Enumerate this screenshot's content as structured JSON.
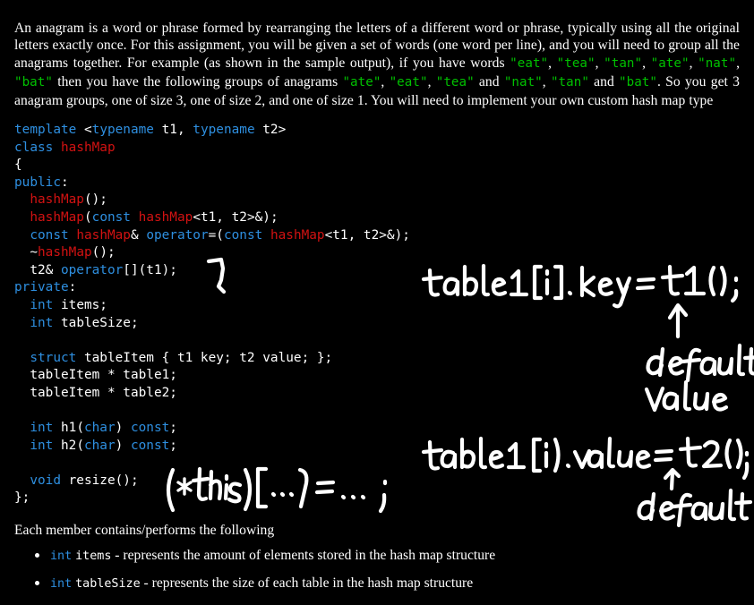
{
  "page": {
    "background_color": "#000000",
    "text_color": "#ffffff"
  },
  "colors": {
    "keyword_blue": "#2e8fe0",
    "class_red": "#d21212",
    "string_green": "#00c000",
    "ink_white": "#ffffff"
  },
  "intro": {
    "part1": "An anagram is a word or phrase formed by rearranging the letters of a different word or phrase, typically using all the original letters exactly once. For this assignment, you will be given a set of words (one word per line), and you will need to group all the anagrams together. For example (as shown in the sample output), if you have words ",
    "w1": "\"eat\"",
    "sep1": ", ",
    "w2": "\"tea\"",
    "sep2": ", ",
    "w3": "\"tan\"",
    "sep3": ", ",
    "w4": "\"ate\"",
    "sep4": ", ",
    "w5": "\"nat\"",
    "sep5": ", ",
    "w6": "\"bat\"",
    "part2": " then you have the following groups of anagrams ",
    "g1": "\"ate\"",
    "gsep1": ", ",
    "g2": "\"eat\"",
    "gsep2": ", ",
    "g3": "\"tea\"",
    "part3": " and ",
    "g4": "\"nat\"",
    "gsep3": ", ",
    "g5": "\"tan\"",
    "part4": " and ",
    "g6": "\"bat\"",
    "part5": ". So you get 3 anagram groups, one of size 3, one of size 2, and one of size 1. You will need to implement your own custom hash map type"
  },
  "code": {
    "language": "cpp",
    "lines": [
      {
        "tokens": [
          {
            "t": "template ",
            "c": "kw"
          },
          {
            "t": "<",
            "c": "pl"
          },
          {
            "t": "typename",
            "c": "kw"
          },
          {
            "t": " t1, ",
            "c": "pl"
          },
          {
            "t": "typename",
            "c": "kw"
          },
          {
            "t": " t2>",
            "c": "pl"
          }
        ]
      },
      {
        "tokens": [
          {
            "t": "class ",
            "c": "kw"
          },
          {
            "t": "hashMap",
            "c": "cls"
          }
        ]
      },
      {
        "tokens": [
          {
            "t": "{",
            "c": "pl"
          }
        ]
      },
      {
        "tokens": [
          {
            "t": "public",
            "c": "kw"
          },
          {
            "t": ":",
            "c": "pl"
          }
        ]
      },
      {
        "tokens": [
          {
            "t": "  ",
            "c": "pl"
          },
          {
            "t": "hashMap",
            "c": "cls"
          },
          {
            "t": "();",
            "c": "pl"
          }
        ]
      },
      {
        "tokens": [
          {
            "t": "  ",
            "c": "pl"
          },
          {
            "t": "hashMap",
            "c": "cls"
          },
          {
            "t": "(",
            "c": "pl"
          },
          {
            "t": "const",
            "c": "kw"
          },
          {
            "t": " ",
            "c": "pl"
          },
          {
            "t": "hashMap",
            "c": "cls"
          },
          {
            "t": "<t1, t2>&);",
            "c": "pl"
          }
        ]
      },
      {
        "tokens": [
          {
            "t": "  ",
            "c": "pl"
          },
          {
            "t": "const",
            "c": "kw"
          },
          {
            "t": " ",
            "c": "pl"
          },
          {
            "t": "hashMap",
            "c": "cls"
          },
          {
            "t": "& ",
            "c": "pl"
          },
          {
            "t": "operator",
            "c": "kw"
          },
          {
            "t": "=(",
            "c": "pl"
          },
          {
            "t": "const",
            "c": "kw"
          },
          {
            "t": " ",
            "c": "pl"
          },
          {
            "t": "hashMap",
            "c": "cls"
          },
          {
            "t": "<t1, t2>&);",
            "c": "pl"
          }
        ]
      },
      {
        "tokens": [
          {
            "t": "  ~",
            "c": "pl"
          },
          {
            "t": "hashMap",
            "c": "cls"
          },
          {
            "t": "();",
            "c": "pl"
          }
        ]
      },
      {
        "tokens": [
          {
            "t": "  t2& ",
            "c": "pl"
          },
          {
            "t": "operator",
            "c": "kw"
          },
          {
            "t": "[](t1);",
            "c": "pl"
          }
        ]
      },
      {
        "tokens": [
          {
            "t": "private",
            "c": "kw"
          },
          {
            "t": ":",
            "c": "pl"
          }
        ]
      },
      {
        "tokens": [
          {
            "t": "  ",
            "c": "pl"
          },
          {
            "t": "int",
            "c": "kw"
          },
          {
            "t": " items;",
            "c": "pl"
          }
        ]
      },
      {
        "tokens": [
          {
            "t": "  ",
            "c": "pl"
          },
          {
            "t": "int",
            "c": "kw"
          },
          {
            "t": " tableSize;",
            "c": "pl"
          }
        ]
      },
      {
        "tokens": [
          {
            "t": "",
            "c": "pl"
          }
        ]
      },
      {
        "tokens": [
          {
            "t": "  ",
            "c": "pl"
          },
          {
            "t": "struct",
            "c": "kw"
          },
          {
            "t": " tableItem { t1 key; t2 value; };",
            "c": "pl"
          }
        ]
      },
      {
        "tokens": [
          {
            "t": "  tableItem * table1;",
            "c": "pl"
          }
        ]
      },
      {
        "tokens": [
          {
            "t": "  tableItem * table2;",
            "c": "pl"
          }
        ]
      },
      {
        "tokens": [
          {
            "t": "",
            "c": "pl"
          }
        ]
      },
      {
        "tokens": [
          {
            "t": "  ",
            "c": "pl"
          },
          {
            "t": "int",
            "c": "kw"
          },
          {
            "t": " h1(",
            "c": "pl"
          },
          {
            "t": "char",
            "c": "kw"
          },
          {
            "t": ") ",
            "c": "pl"
          },
          {
            "t": "const",
            "c": "kw"
          },
          {
            "t": ";",
            "c": "pl"
          }
        ]
      },
      {
        "tokens": [
          {
            "t": "  ",
            "c": "pl"
          },
          {
            "t": "int",
            "c": "kw"
          },
          {
            "t": " h2(",
            "c": "pl"
          },
          {
            "t": "char",
            "c": "kw"
          },
          {
            "t": ") ",
            "c": "pl"
          },
          {
            "t": "const",
            "c": "kw"
          },
          {
            "t": ";",
            "c": "pl"
          }
        ]
      },
      {
        "tokens": [
          {
            "t": "",
            "c": "pl"
          }
        ]
      },
      {
        "tokens": [
          {
            "t": "  ",
            "c": "pl"
          },
          {
            "t": "void",
            "c": "kw"
          },
          {
            "t": " resize();",
            "c": "pl"
          }
        ]
      },
      {
        "tokens": [
          {
            "t": "};",
            "c": "pl"
          }
        ]
      }
    ]
  },
  "annotations": {
    "bracket_operator": {
      "text": "]",
      "kind": "hand-drawn-bracket"
    },
    "note_key": {
      "text": "table1[i].key = t1();"
    },
    "note_key_arrow": {
      "text": "↑"
    },
    "note_key_caption_line1": {
      "text": "default"
    },
    "note_key_caption_line2": {
      "text": "value"
    },
    "note_value": {
      "text": "table1[i].value = t2();"
    },
    "note_value_arrow": {
      "text": "↑"
    },
    "note_value_caption": {
      "text": "default"
    },
    "note_deref": {
      "text": "(*this)[...] = ... ;"
    }
  },
  "closing": {
    "lead_in": "Each member contains/performs the following",
    "members": [
      {
        "type": "int",
        "name": "items",
        "dash": " - ",
        "description": "represents the amount of elements stored in the hash map structure"
      },
      {
        "type": "int",
        "name": "tableSize",
        "dash": " - ",
        "description": "represents the size of each table in the hash map structure"
      }
    ]
  }
}
